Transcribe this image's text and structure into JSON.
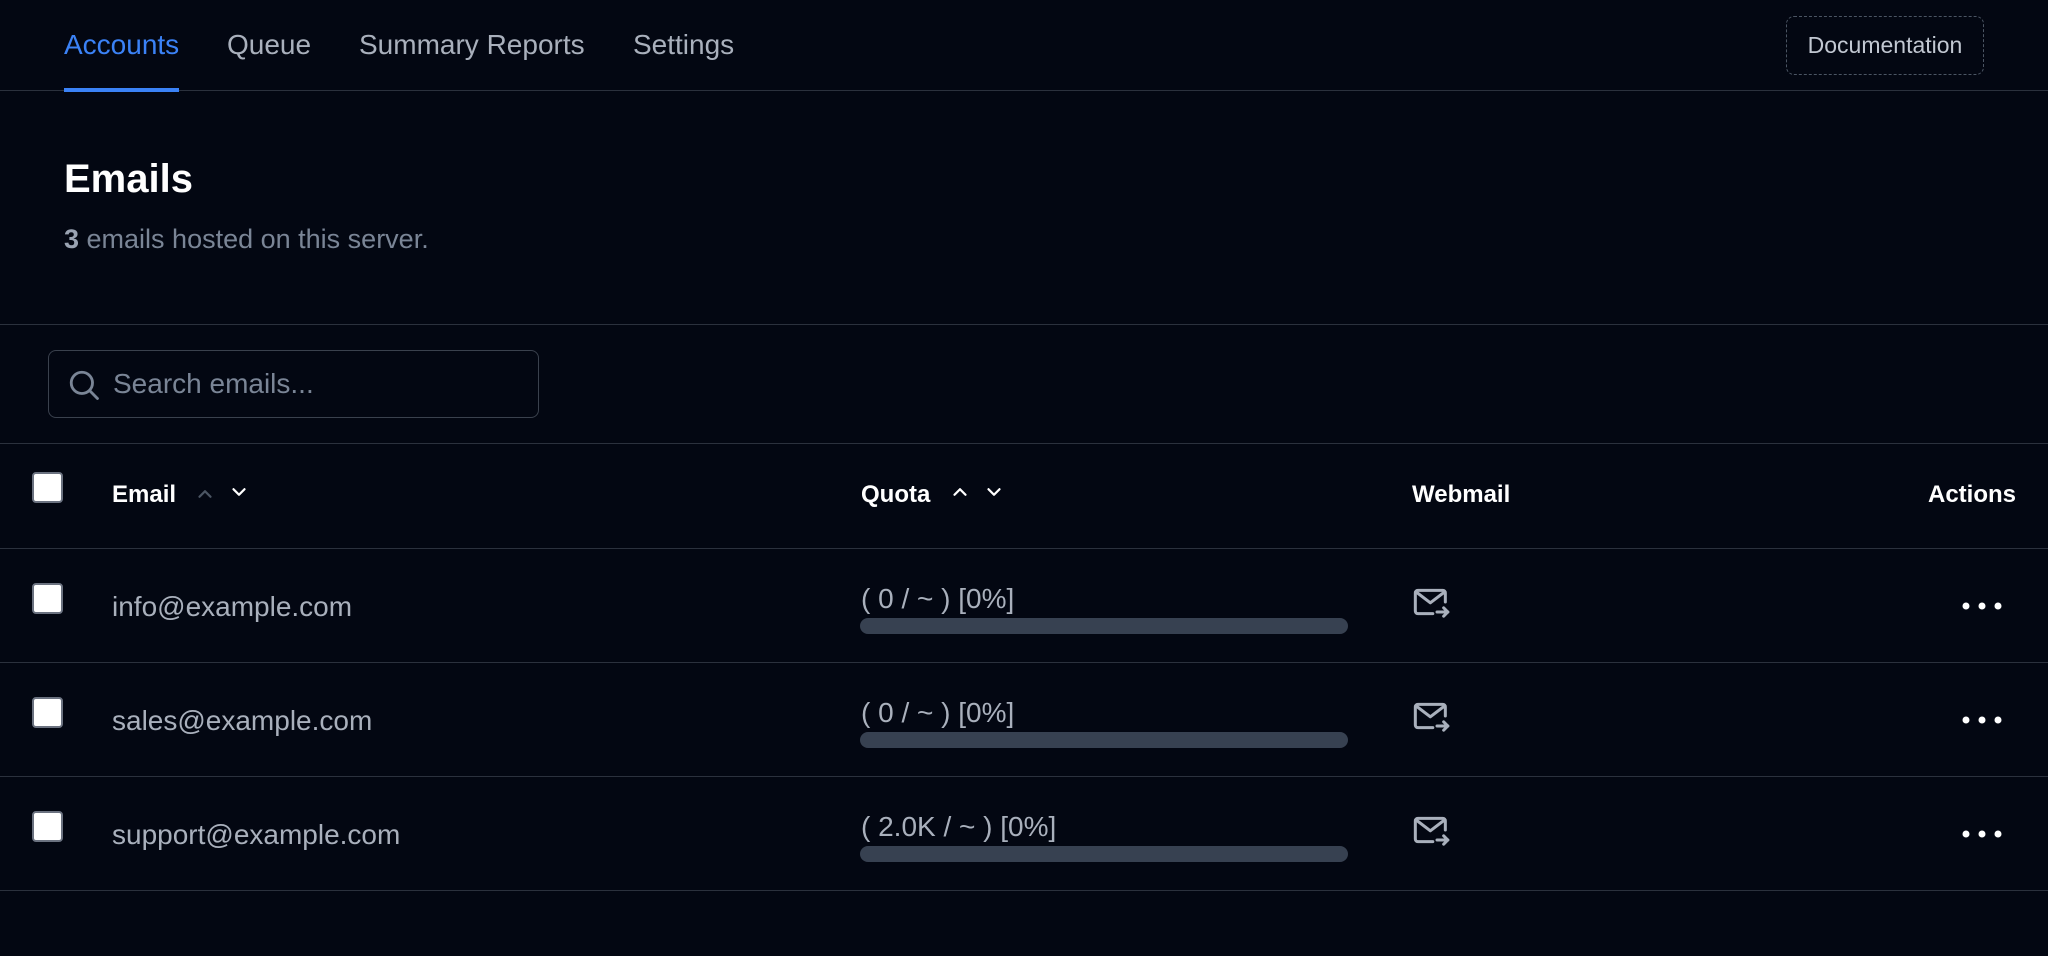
{
  "nav": {
    "tabs": [
      {
        "label": "Accounts",
        "active": true
      },
      {
        "label": "Queue",
        "active": false
      },
      {
        "label": "Summary Reports",
        "active": false
      },
      {
        "label": "Settings",
        "active": false
      }
    ],
    "documentation_label": "Documentation"
  },
  "header": {
    "title": "Emails",
    "count": "3",
    "subtitle_rest": " emails hosted on this server."
  },
  "search": {
    "placeholder": "Search emails...",
    "value": "",
    "icon": "search-icon"
  },
  "table": {
    "columns": {
      "email": "Email",
      "quota": "Quota",
      "webmail": "Webmail",
      "actions": "Actions"
    },
    "rows": [
      {
        "email": "info@example.com",
        "quota_text": "( 0 / ~ ) [0%]",
        "quota_percent": 0
      },
      {
        "email": "sales@example.com",
        "quota_text": "( 0 / ~ ) [0%]",
        "quota_percent": 0
      },
      {
        "email": "support@example.com",
        "quota_text": "( 2.0K / ~ ) [0%]",
        "quota_percent": 0
      }
    ]
  },
  "colors": {
    "background": "#030712",
    "accent": "#3b82f6",
    "border": "#2b313d",
    "muted_text": "#a9b0bc"
  }
}
